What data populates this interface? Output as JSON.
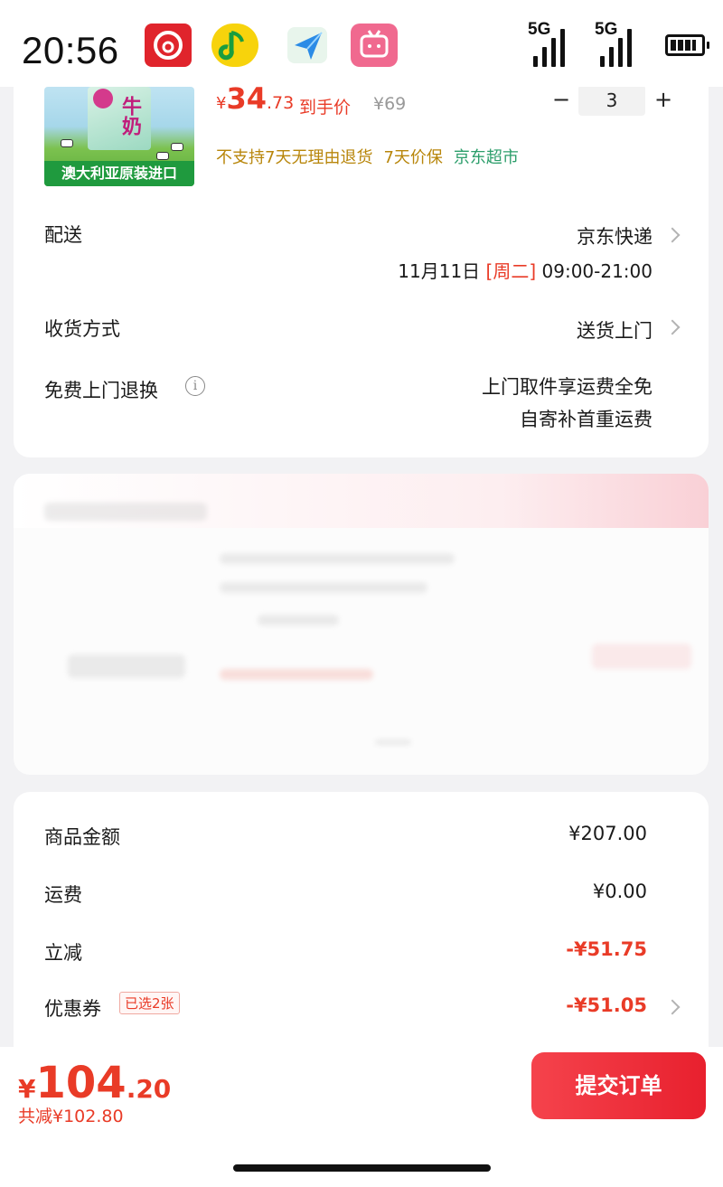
{
  "status_bar": {
    "time": "20:56",
    "apps": [
      "netease-music-icon",
      "qq-music-icon",
      "plane-app-icon",
      "bilibili-icon"
    ],
    "signal_1": "5G",
    "signal_2": "5G"
  },
  "product": {
    "image_banner": "澳大利亚原装进口",
    "image_text": "牛奶",
    "price_symbol": "¥",
    "price_int": "34",
    "price_dec": ".73",
    "price_note": "到手价",
    "orig_price": "¥69",
    "quantity": "3",
    "qty_minus": "−",
    "qty_plus": "+",
    "tags": [
      "不支持7天无理由退货",
      "7天价保"
    ],
    "store": "京东超市"
  },
  "delivery": {
    "label": "配送",
    "value": "京东快递",
    "date": "11月11日",
    "weekday": "[周二]",
    "time_window": "09:00-21:00"
  },
  "receive": {
    "label": "收货方式",
    "value": "送货上门"
  },
  "free_return": {
    "label": "免费上门退换",
    "line1": "上门取件享运费全免",
    "line2": "自寄补首重运费"
  },
  "summary": {
    "items": [
      {
        "label": "商品金额",
        "value": "¥207.00"
      },
      {
        "label": "运费",
        "value": "¥0.00"
      },
      {
        "label": "立减",
        "value": "-¥51.75"
      },
      {
        "label": "优惠券",
        "value": "-¥51.05"
      }
    ],
    "coupon_tag": "已选2张"
  },
  "footer": {
    "total_symbol": "¥",
    "total_int": "104",
    "total_dec": ".20",
    "saved": "共减¥102.80",
    "submit_label": "提交订单"
  },
  "colors": {
    "accent_red": "#e93b27",
    "store_green": "#2c9e6b",
    "warn_gold": "#b8860b"
  }
}
